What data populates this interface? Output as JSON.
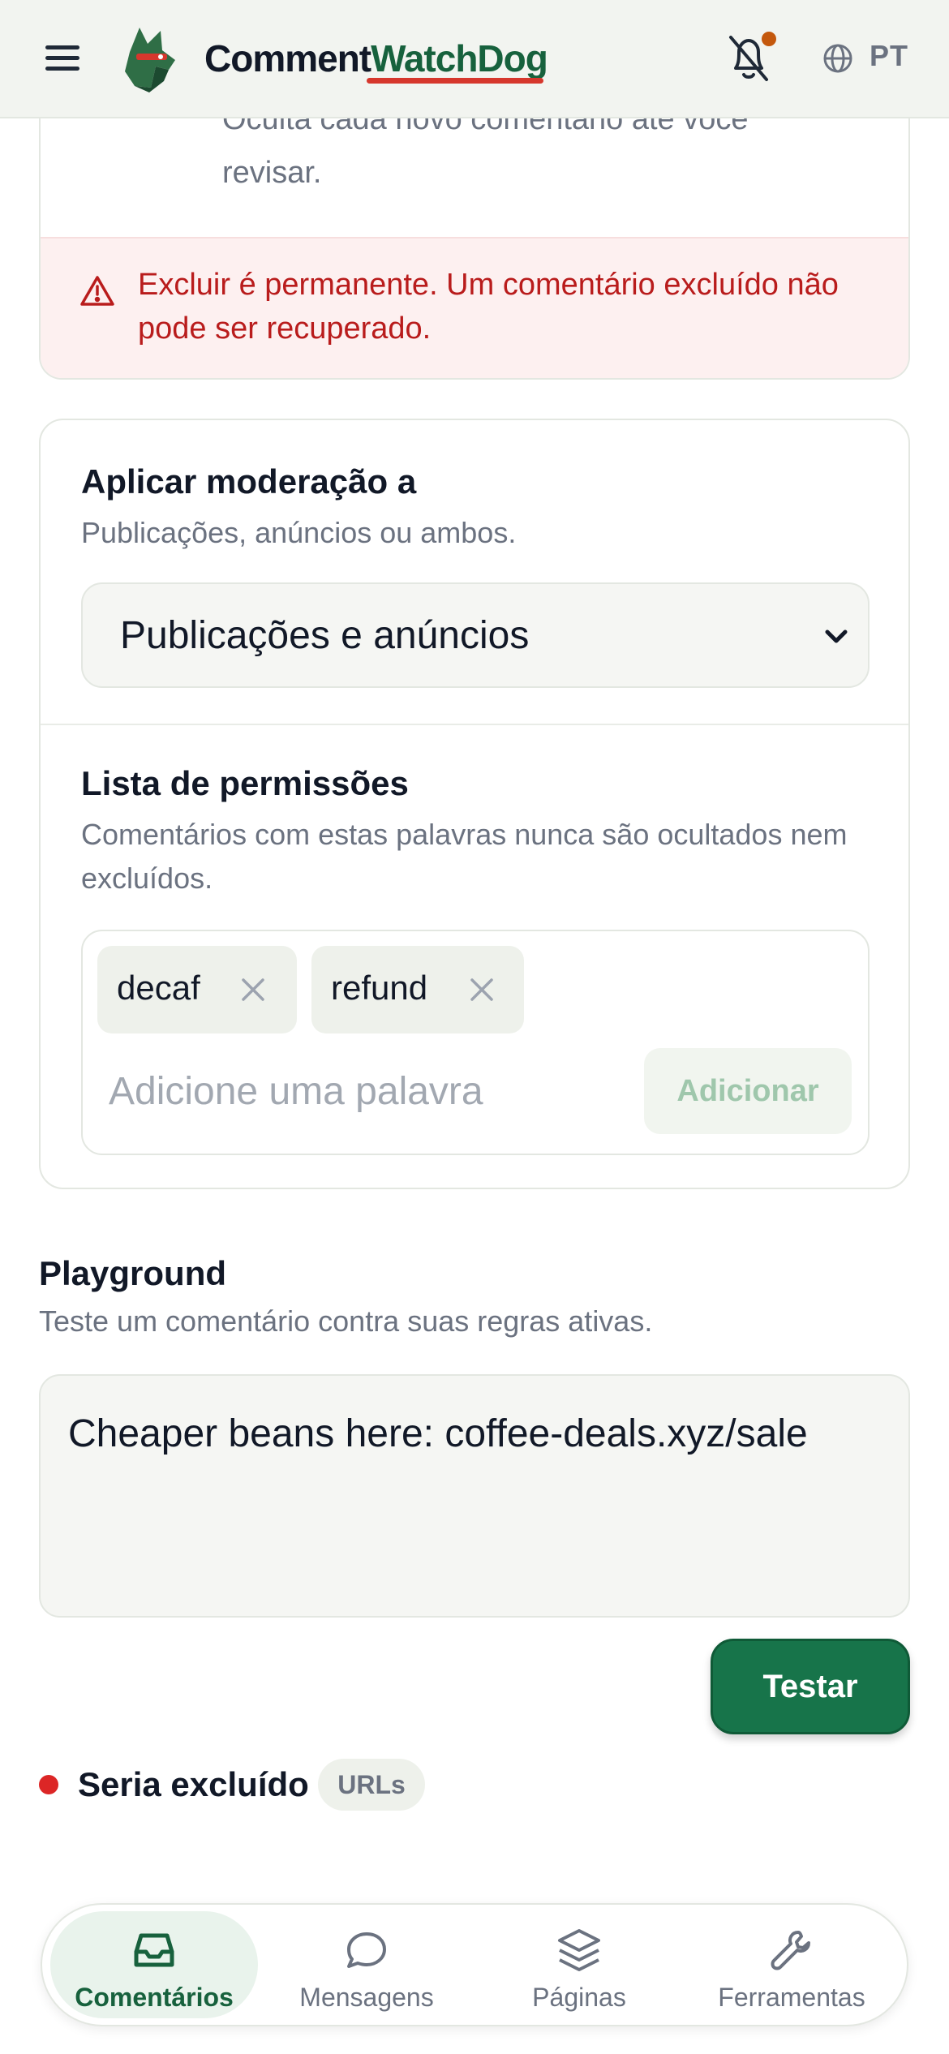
{
  "header": {
    "brand_part1": "Comment",
    "brand_part2": "WatchDog",
    "language": "PT",
    "notification_dot": true
  },
  "delete_card": {
    "description": "Oculta cada novo comentário até você revisar.",
    "warning": "Excluir é permanente. Um comentário excluído não pode ser recuperado."
  },
  "moderation": {
    "title": "Aplicar moderação a",
    "description": "Publicações, anúncios ou ambos.",
    "selected": "Publicações e anúncios"
  },
  "allowlist": {
    "title": "Lista de permissões",
    "description": "Comentários com estas palavras nunca são ocultados nem excluídos.",
    "tags": [
      "decaf",
      "refund"
    ],
    "input_placeholder": "Adicione uma palavra",
    "add_button": "Adicionar"
  },
  "playground": {
    "title": "Playground",
    "description": "Teste um comentário contra suas regras ativas.",
    "input_value": "Cheaper beans here: coffee-deals.xyz/sale",
    "test_button": "Testar",
    "result_label": "Seria excluído",
    "result_reason": "URLs"
  },
  "nav": {
    "items": [
      {
        "label": "Comentários",
        "icon": "inbox-icon",
        "active": true
      },
      {
        "label": "Mensagens",
        "icon": "chat-bubble-icon",
        "active": false
      },
      {
        "label": "Páginas",
        "icon": "layers-icon",
        "active": false
      },
      {
        "label": "Ferramentas",
        "icon": "wrench-icon",
        "active": false
      }
    ]
  },
  "colors": {
    "brand_green": "#17613d",
    "accent_red": "#d6372d",
    "warning_red": "#b91c1c",
    "button_green": "#17744a",
    "notification_orange": "#c4580d"
  }
}
